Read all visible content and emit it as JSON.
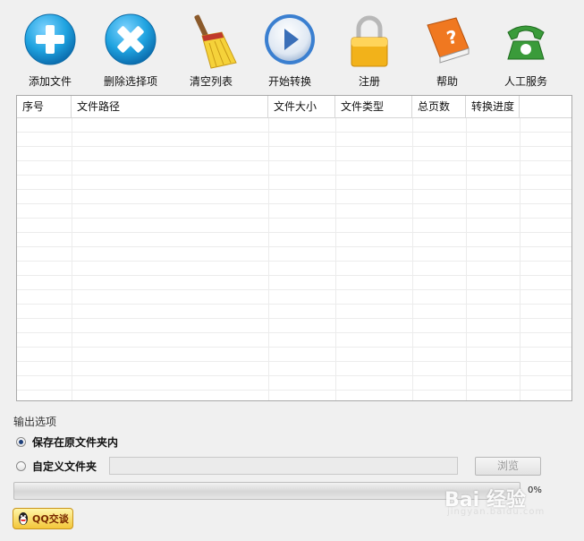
{
  "toolbar": {
    "add_file": "添加文件",
    "delete_selected": "删除选择项",
    "clear_list": "清空列表",
    "start_convert": "开始转换",
    "register": "注册",
    "help": "帮助",
    "manual_service": "人工服务"
  },
  "table": {
    "columns": [
      "序号",
      "文件路径",
      "文件大小",
      "文件类型",
      "总页数",
      "转换进度"
    ],
    "rows": []
  },
  "output": {
    "title": "输出选项",
    "option_original": "保存在原文件夹内",
    "option_custom": "自定义文件夹",
    "selected": "original",
    "custom_path": "",
    "browse_label": "浏览"
  },
  "progress": {
    "value": 0,
    "label": "0%"
  },
  "qq_button": {
    "label": "QQ交谈"
  },
  "watermark": {
    "main": "Bai 经验",
    "sub": "jingyan.baidu.com"
  },
  "colors": {
    "add_blue": "#1fa3e0",
    "delete_blue": "#2a9fd8",
    "play_blue": "#3a7fd0",
    "lock_gold": "#f2b21a",
    "help_orange": "#f07820",
    "phone_green": "#3a9b3a",
    "radio_dot": "#1e3f7a"
  }
}
